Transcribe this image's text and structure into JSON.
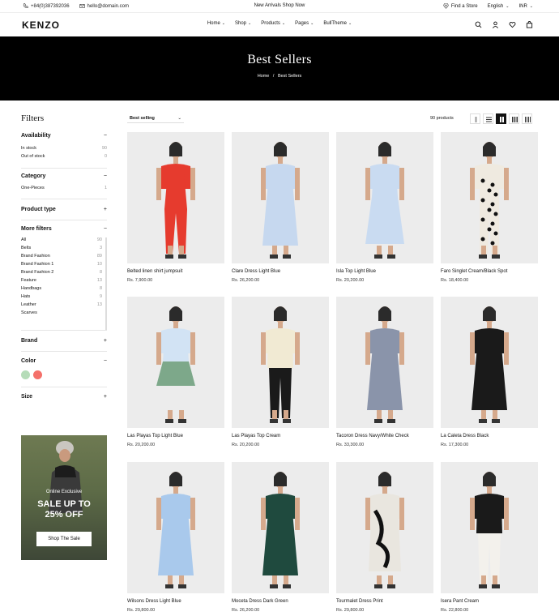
{
  "topbar": {
    "phone": "+84(0)387392036",
    "email": "hello@domain.com",
    "announcement": "New Arrivals Shop Now",
    "store": "Find a Store",
    "language": "English",
    "currency": "INR"
  },
  "header": {
    "logo": "KENZO",
    "nav": [
      {
        "label": "Home"
      },
      {
        "label": "Shop"
      },
      {
        "label": "Products"
      },
      {
        "label": "Pages"
      },
      {
        "label": "BullTheme"
      }
    ]
  },
  "hero": {
    "title": "Best Sellers",
    "crumb_home": "Home",
    "crumb_sep": "/",
    "crumb_current": "Best Sellers"
  },
  "filters": {
    "title": "Filters",
    "availability": {
      "title": "Availability",
      "items": [
        {
          "label": "In stock",
          "count": "90"
        },
        {
          "label": "Out of stock",
          "count": "0"
        }
      ]
    },
    "category": {
      "title": "Category",
      "items": [
        {
          "label": "One-Pieces",
          "count": "1"
        }
      ]
    },
    "product_type": {
      "title": "Product type"
    },
    "more_filters": {
      "title": "More filters",
      "items": [
        {
          "label": "All",
          "count": "90"
        },
        {
          "label": "Belts",
          "count": "3"
        },
        {
          "label": "Brand Fashion",
          "count": "89"
        },
        {
          "label": "Brand Fashion 1",
          "count": "10"
        },
        {
          "label": "Brand Fashion 2",
          "count": "8"
        },
        {
          "label": "Feature",
          "count": "13"
        },
        {
          "label": "Handbags",
          "count": "8"
        },
        {
          "label": "Hats",
          "count": "9"
        },
        {
          "label": "Leather",
          "count": "13"
        },
        {
          "label": "Scarves",
          "count": ""
        }
      ]
    },
    "brand": {
      "title": "Brand"
    },
    "color": {
      "title": "Color",
      "swatches": [
        "#b5dcb8",
        "#f4706a"
      ]
    },
    "size": {
      "title": "Size"
    },
    "minus": "−",
    "plus": "+"
  },
  "promo": {
    "subtitle": "Online Exclusive",
    "headline_1": "SALE UP TO",
    "headline_2": "25% OFF",
    "button": "Shop The Sale"
  },
  "toolbar": {
    "sort": "Best selling",
    "count": "90 products"
  },
  "products": [
    {
      "name": "Belted linen shirt jumpsuit",
      "price": "Rs. 7,900.00",
      "outfit": "#e63b2e",
      "bg": "#ececec",
      "style": "jumpsuit"
    },
    {
      "name": "Clare Dress Light Blue",
      "price": "Rs. 26,200.00",
      "outfit": "#c6d8ef",
      "bg": "#ececec",
      "style": "dress"
    },
    {
      "name": "Isla Top Light Blue",
      "price": "Rs. 20,200.00",
      "outfit": "#c9dbf1",
      "bg": "#ececec",
      "style": "skirt"
    },
    {
      "name": "Faro Singlet Cream/Black Spot",
      "price": "Rs. 18,400.00",
      "outfit": "#efeae0",
      "bg": "#ececec",
      "style": "spot"
    },
    {
      "name": "Las Playas Top Light Blue",
      "price": "Rs. 20,200.00",
      "outfit": "#d2e3f4",
      "bg": "#ececec",
      "style": "topskirt"
    },
    {
      "name": "Las Playas Top Cream",
      "price": "Rs. 20,200.00",
      "outfit": "#f1ead3",
      "bg": "#ececec",
      "style": "pants"
    },
    {
      "name": "Tacoron Dress Navy/White Check",
      "price": "Rs. 33,300.00",
      "outfit": "#8a94aa",
      "bg": "#ececec",
      "style": "dress"
    },
    {
      "name": "La Caleta Dress Black",
      "price": "Rs. 17,300.00",
      "outfit": "#1a1a1a",
      "bg": "#ececec",
      "style": "dress"
    },
    {
      "name": "Wilsons Dress Light Blue",
      "price": "Rs. 29,800.00",
      "outfit": "#a9c9ec",
      "bg": "#ececec",
      "style": "dress"
    },
    {
      "name": "Moceta Dress Dark Green",
      "price": "Rs. 26,200.00",
      "outfit": "#1f4a3e",
      "bg": "#ececec",
      "style": "dress"
    },
    {
      "name": "Tourmalet Dress Print",
      "price": "Rs. 29,800.00",
      "outfit": "#e9e6df",
      "bg": "#ececec",
      "style": "print"
    },
    {
      "name": "Isera Pant Cream",
      "price": "Rs. 22,800.00",
      "outfit": "#f3f1ec",
      "bg": "#ececec",
      "style": "pantsdark"
    }
  ]
}
